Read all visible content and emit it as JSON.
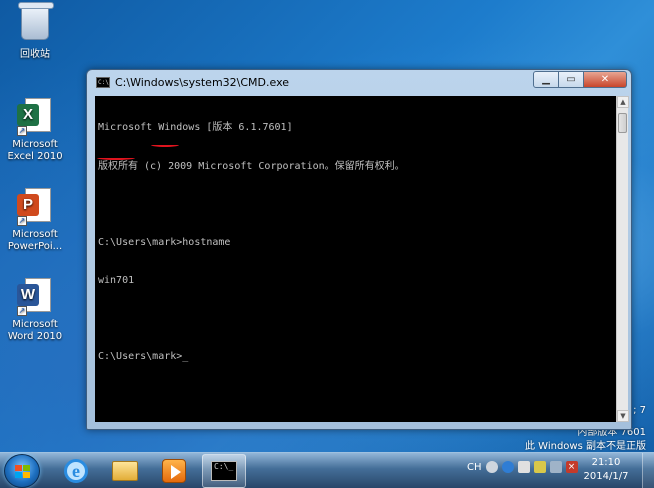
{
  "desktop": {
    "icons": [
      {
        "label_line1": "回收站",
        "label_line2": "",
        "icon": "recycle-bin-icon"
      },
      {
        "label_line1": "Microsoft",
        "label_line2": "Excel 2010",
        "icon": "excel-icon",
        "badge": "X",
        "color": "#1e7145"
      },
      {
        "label_line1": "Microsoft",
        "label_line2": "PowerPoi...",
        "icon": "powerpoint-icon",
        "badge": "P",
        "color": "#d04a1e"
      },
      {
        "label_line1": "Microsoft",
        "label_line2": "Word 2010",
        "icon": "word-icon",
        "badge": "W",
        "color": "#2a5699"
      }
    ],
    "watermark": {
      "partial": "; 7",
      "build": "内部版本 7601",
      "notice": "此 Windows 副本不是正版"
    }
  },
  "cmd_window": {
    "title": "C:\\Windows\\system32\\CMD.exe",
    "lines": [
      "Microsoft Windows [版本 6.1.7601]",
      "版权所有 (c) 2009 Microsoft Corporation。保留所有权利。",
      "",
      "C:\\Users\\mark>hostname",
      "win701",
      "",
      "C:\\Users\\mark>_"
    ],
    "colors": {
      "background": "#000000",
      "text": "#c0c0c0",
      "annotation": "#e0141e"
    }
  },
  "taskbar": {
    "tray_lang": "CH",
    "time": "21:10",
    "date": "2014/1/7"
  }
}
